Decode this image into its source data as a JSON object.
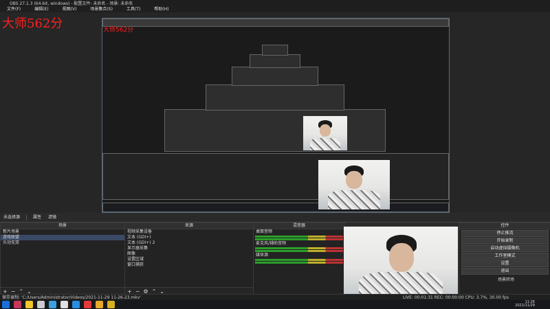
{
  "window": {
    "title": "OBS 27.1.3 (64-bit, windows) - 配置文件: 未命名 - 场景: 未命名"
  },
  "menu": [
    "文件(F)",
    "编辑(E)",
    "视图(V)",
    "场景集合(S)",
    "工具(T)",
    "帮助(H)"
  ],
  "overlay": {
    "text": "大师562分",
    "color": "#ff2020"
  },
  "dockbar": {
    "scene_label": "未选择源",
    "properties": "属性",
    "filters": "滤镜"
  },
  "scenes": {
    "header": "场景",
    "items": [
      "新片场景",
      "游戏联盟",
      "头动无双"
    ]
  },
  "sources": {
    "header": "来源",
    "items": [
      "视频采集设备",
      "文本 (GDI+)",
      "文本 (GDI+) 2",
      "显示器采集",
      "图像",
      "设置区域",
      "窗口捕获"
    ]
  },
  "mixer": {
    "header": "混音器",
    "channels": [
      "桌面音频",
      "麦克风/辅助音频",
      "媒体源"
    ]
  },
  "controls": {
    "header": "控件",
    "buttons": [
      "停止推流",
      "开始录制",
      "启动虚拟摄像机",
      "工作室模式",
      "设置",
      "退出"
    ],
    "transition_label": "场景转场"
  },
  "statusbar": {
    "text": "保存录制: 'C:/Users/Administrator/Videos/2021-11-29 11-26-23.mkv'",
    "stats": "LIVE: 00:01:31  REC: 00:00:00  CPU: 3.7%, 30.00 fps"
  },
  "taskbar": {
    "time": "11:26",
    "date": "2021/11/29",
    "icon_colors": [
      "#c7375c",
      "#f0c62a",
      "#cccccc",
      "#3aa0e0",
      "#e0e0e0",
      "#2a8ee0",
      "#e33a3a",
      "#e8a82a",
      "#d8b020"
    ]
  }
}
